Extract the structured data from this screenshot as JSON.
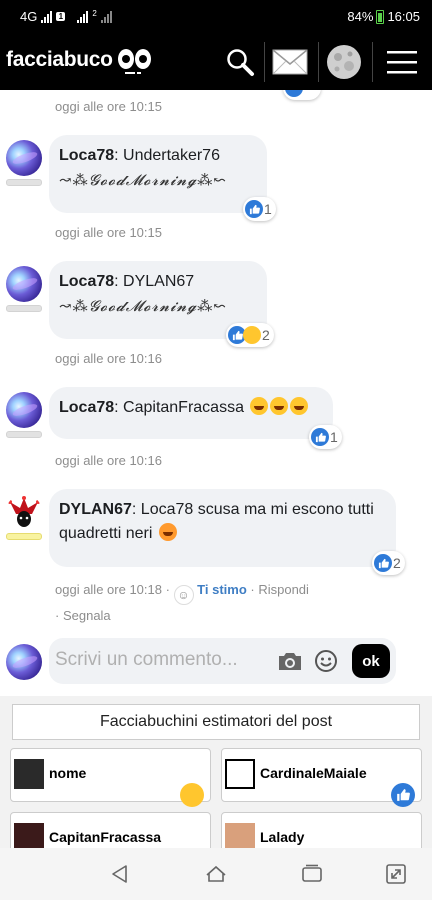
{
  "statusbar": {
    "network": "4G",
    "sim1_badge": "1",
    "sim2_badge": "2",
    "battery": "84%",
    "time": "16:05"
  },
  "header": {
    "logo": "facciabuco",
    "icons": [
      "search-icon",
      "mail-icon",
      "moon-avatar-icon",
      "menu-icon"
    ]
  },
  "comments": [
    {
      "timestamp": "oggi alle ore 10:15"
    },
    {
      "author": "Loca78",
      "sep": ": ",
      "text": "Undertaker76",
      "fancy": "↝⁂𝓖𝓸𝓸𝓭𝓜𝓸𝓻𝓷𝓲𝓷𝓰⁂↜",
      "reaction_count": "1",
      "timestamp": "oggi alle ore 10:15"
    },
    {
      "author": "Loca78",
      "sep": ": ",
      "text": "DYLAN67",
      "fancy": "↝⁂𝓖𝓸𝓸𝓭𝓜𝓸𝓻𝓷𝓲𝓷𝓰⁂↜",
      "reaction_count": "2",
      "timestamp": "oggi alle ore 10:16"
    },
    {
      "author": "Loca78",
      "sep": ": ",
      "text": "CapitanFracassa",
      "reaction_count": "1",
      "timestamp": "oggi alle ore 10:16"
    },
    {
      "author": "DYLAN67",
      "sep": ": ",
      "text": "Loca78 scusa ma mi escono tutti quadretti neri",
      "reaction_count": "2",
      "timestamp": "oggi alle ore 10:18",
      "action_sep1": " · ",
      "action_like": "Ti stimo",
      "action_sep2": " · ",
      "action_reply": "Rispondi",
      "action_sep3": " · ",
      "action_report": "Segnala"
    }
  ],
  "comment_box": {
    "placeholder": "Scrivi un commento...",
    "submit": "ok"
  },
  "estimators": {
    "title": "Facciabuchini estimatori del post",
    "cards": [
      {
        "name": "nome",
        "reaction": "smile"
      },
      {
        "name": "CardinaleMaiale",
        "reaction": "like"
      },
      {
        "name": "CapitanFracassa",
        "reaction": "like"
      },
      {
        "name": "Lalady",
        "reaction": "smile"
      }
    ]
  },
  "navbar": {
    "icons": [
      "back-icon",
      "home-icon",
      "recents-icon",
      "screen-rotate-icon"
    ]
  }
}
